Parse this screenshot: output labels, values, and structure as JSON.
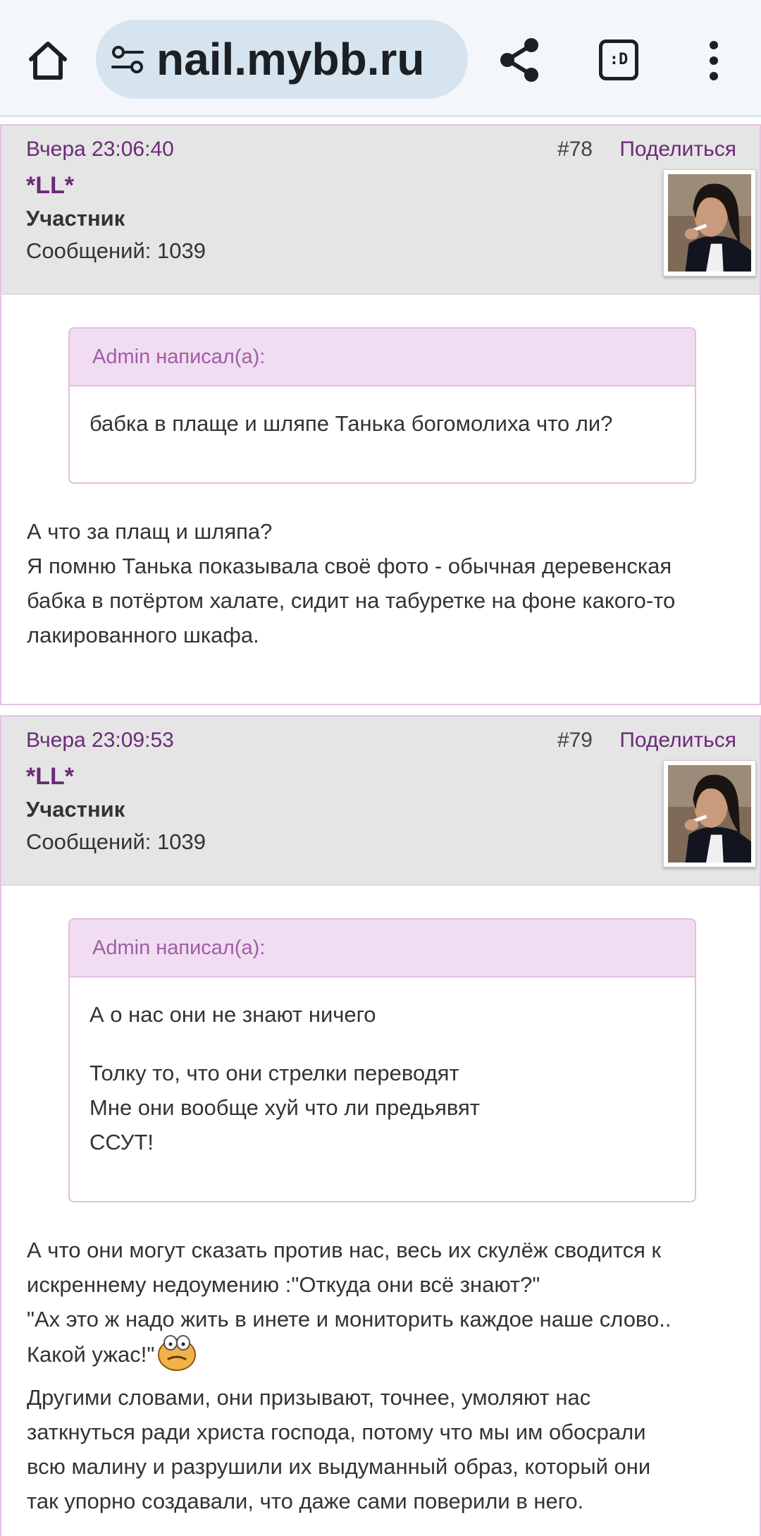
{
  "browser": {
    "url": "nail.mybb.ru",
    "tab_switcher_label": ":D"
  },
  "posts": [
    {
      "date": "Вчера 23:06:40",
      "number": "#78",
      "share_label": "Поделиться",
      "author": "*LL*",
      "role": "Участник",
      "messages": "Сообщений: 1039",
      "quote": {
        "header": "Admin написал(а):",
        "lines": [
          "бабка в плаще и шляпе Танька богомолиха что ли?"
        ]
      },
      "text_lines": [
        "А что за плащ и шляпа?",
        "Я помню Танька показывала своё фото - обычная деревенская",
        "бабка в потёртом халате,  сидит на табуретке на фоне какого-то",
        "лакированного шкафа."
      ]
    },
    {
      "date": "Вчера 23:09:53",
      "number": "#79",
      "share_label": "Поделиться",
      "author": "*LL*",
      "role": "Участник",
      "messages": "Сообщений: 1039",
      "quote": {
        "header": "Admin написал(а):",
        "paragraph1": "А о нас они не знают ничего",
        "paragraph2": [
          "Толку то, что они стрелки переводят",
          "Мне они вообще  хуй что ли предьявят",
          "ССУТ!"
        ]
      },
      "text_lines": [
        "А что они могут сказать против нас, весь их скулёж сводится к",
        "искреннему недоумению :\"Откуда они всё знают?\"",
        "\"Ах это ж надо жить в инете и мониторить каждое наше слово..",
        "Какой ужас!\"",
        "Другими словами, они призывают, точнее, умоляют нас",
        "заткнуться ради христа господа, потому что мы им обосрали",
        "всю малину и разрушили их выдуманный образ, который они",
        "так упорно создавали, что даже сами поверили в него."
      ]
    }
  ]
}
